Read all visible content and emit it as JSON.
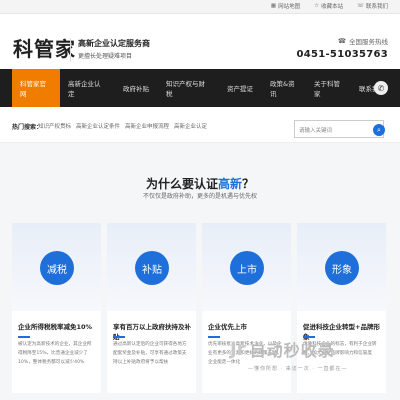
{
  "topbar": {
    "links": [
      "网站地图",
      "收藏本站",
      "联系我们"
    ]
  },
  "header": {
    "logo": "科管家",
    "slogan_main": "高新企业认定服务商",
    "slogan_sub": "更擅长处理疑难项目",
    "hotline_label": "全国服务热线",
    "hotline_number": "0451-51035763"
  },
  "nav": {
    "items": [
      "科管家官网",
      "高新企业认定",
      "政府补贴",
      "知识产权与财税",
      "资产提证",
      "政策&资讯",
      "关于科管家",
      "联系我们"
    ],
    "active_index": 0
  },
  "breadcrumb": {
    "title": "热门搜索：",
    "items": [
      "知识产权贯标",
      "高新企业认定条件",
      "高新企业申报流程",
      "高新企业认定"
    ]
  },
  "search": {
    "placeholder": "请输入关键词"
  },
  "section": {
    "title_prefix": "为什么要认证",
    "title_highlight": "高新",
    "title_suffix": "？",
    "subtitle": "不仅仅是政府补助，更多的是机遇与优先权"
  },
  "cards": [
    {
      "badge": "减税",
      "title": "企业所得税税率减免10%",
      "text": "被认定为高新技术的企业，其企业所得税降至15%，比普通企业减少了10%，整体税务都可以减少40%"
    },
    {
      "badge": "补贴",
      "title": "享有百万以上政府扶持及补贴",
      "text": "通过高新认定后的企业可获得各地方配套奖金及补贴，可享有通过政策支持以上补贴政府将予以帮扶"
    },
    {
      "badge": "上市",
      "title": "企业优先上市",
      "text": "优先审核批准高新技术企业，以及企业有更多的资源和更好的政策支持，企业能走一体化"
    },
    {
      "badge": "形象",
      "title": "促进科技企业转型+品牌形象",
      "text": "优质科技企业的标志，有利于企业转型，加大企业品牌影响力和信誉度"
    }
  ],
  "watermark": {
    "logo": "自动秒收录",
    "sub": "—懂你所想 · 来访一次 · 一直都在—"
  },
  "colors": {
    "accent": "#f07d00",
    "primary": "#1e6fd9",
    "nav_bg": "#1e1e1e"
  }
}
